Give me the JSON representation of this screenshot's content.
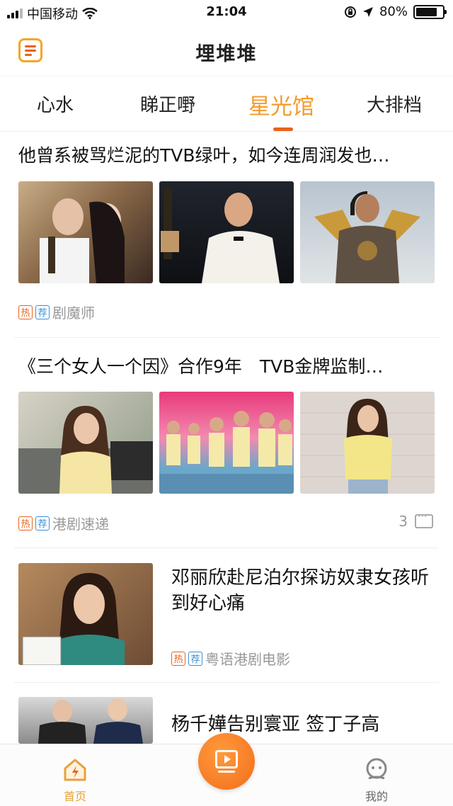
{
  "status_bar": {
    "carrier": "中国移动",
    "time": "21:04",
    "battery": "80%",
    "battery_level": 0.8
  },
  "header": {
    "title": "埋堆堆"
  },
  "tabs": [
    {
      "label": "心水",
      "active": false
    },
    {
      "label": "睇正嘢",
      "active": false
    },
    {
      "label": "星光馆",
      "active": true
    },
    {
      "label": "大排档",
      "active": false
    }
  ],
  "tags": {
    "hot": "热",
    "recommend": "荐"
  },
  "articles": [
    {
      "title": "他曾系被骂烂泥的TVB绿叶，如今连周润发也…",
      "source": "剧魔师",
      "comments": ""
    },
    {
      "title": "《三个女人一个因》合作9年　TVB金牌监制…",
      "source": "港剧速递",
      "comments": "3"
    },
    {
      "title": "邓丽欣赴尼泊尔探访奴隶女孩听到好心痛",
      "source": "粤语港剧电影",
      "comments": ""
    },
    {
      "title": "杨千嬅告别寰亚 签丁子高",
      "source": "",
      "comments": ""
    }
  ],
  "bottom_nav": {
    "home": "首页",
    "me": "我的"
  },
  "colors": {
    "accent": "#f39b2c",
    "accent_dark": "#e8631c",
    "tag_blue": "#3b8fd6"
  }
}
